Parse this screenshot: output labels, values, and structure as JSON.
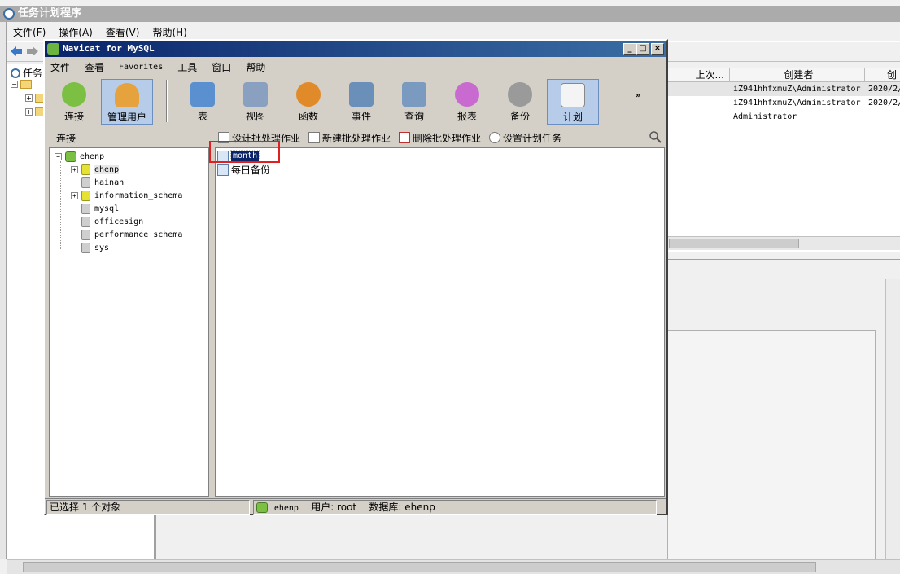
{
  "task_scheduler": {
    "title": "任务计划程序",
    "menu": [
      "文件(F)",
      "操作(A)",
      "查看(V)",
      "帮助(H)"
    ],
    "tree_root": "任务",
    "columns": [
      "上次...",
      "创建者",
      "创"
    ],
    "rows": [
      {
        "author": "iZ941hhfxmuZ\\Administrator",
        "date": "2020/2/"
      },
      {
        "author": "iZ941hhfxmuZ\\Administrator",
        "date": "2020/2/"
      },
      {
        "author": "Administrator",
        "date": ""
      }
    ]
  },
  "navicat": {
    "title": "Navicat for MySQL",
    "menu": [
      "文件",
      "查看",
      "Favorites",
      "工具",
      "窗口",
      "帮助"
    ],
    "toolbar": [
      {
        "label": "连接",
        "icon": "connect-icon",
        "color": "#7bc043"
      },
      {
        "label": "管理用户",
        "icon": "user-icon",
        "color": "#e6a23c"
      },
      {
        "label": "表",
        "icon": "table-icon",
        "color": "#5a8fd0"
      },
      {
        "label": "视图",
        "icon": "view-icon",
        "color": "#8aa0c0"
      },
      {
        "label": "函数",
        "icon": "function-icon",
        "color": "#e08a2a"
      },
      {
        "label": "事件",
        "icon": "event-icon",
        "color": "#6a8fb8"
      },
      {
        "label": "查询",
        "icon": "query-icon",
        "color": "#7a9ac0"
      },
      {
        "label": "报表",
        "icon": "report-icon",
        "color": "#c86ad0"
      },
      {
        "label": "备份",
        "icon": "backup-icon",
        "color": "#9a9a9a"
      },
      {
        "label": "计划",
        "icon": "schedule-icon",
        "color": "#c0c0c0"
      }
    ],
    "connection_label": "连接",
    "actions": [
      "设计批处理作业",
      "新建批处理作业",
      "删除批处理作业",
      "设置计划任务"
    ],
    "tree": {
      "connection": "ehenp",
      "databases": [
        "ehenp",
        "hainan",
        "information_schema",
        "mysql",
        "officesign",
        "performance_schema",
        "sys"
      ]
    },
    "jobs": [
      "month",
      "每日备份"
    ],
    "status": {
      "selection": "已选择 1 个对象",
      "connection": "ehenp",
      "user": "用户: root",
      "database": "数据库: ehenp"
    },
    "selected_item": "month",
    "highlight_color": "#e02020"
  }
}
